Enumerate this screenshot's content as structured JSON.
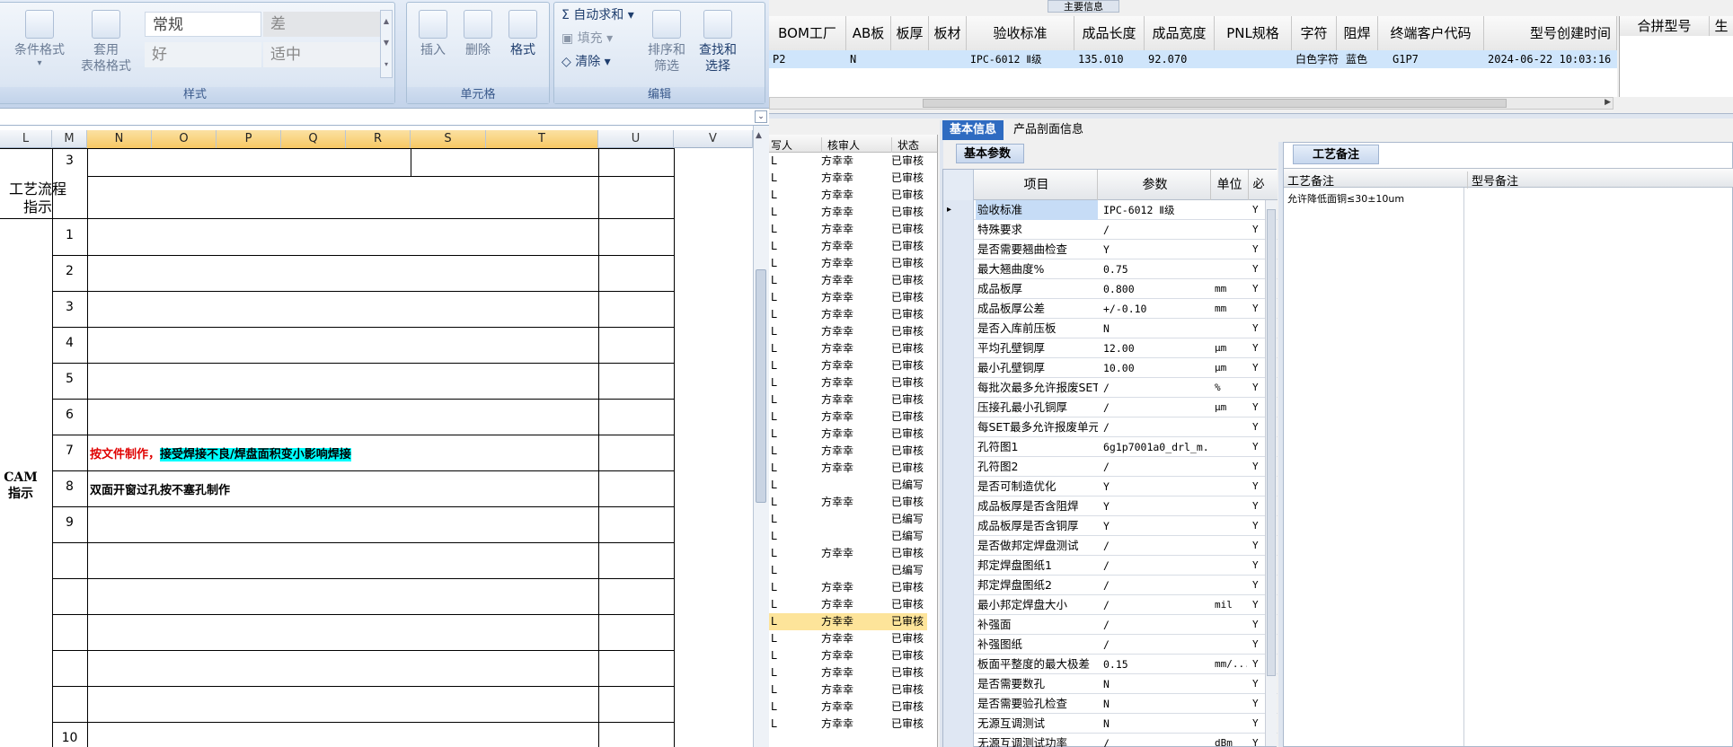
{
  "ribbon": {
    "cond_format": "条件格式",
    "table_format_1": "套用",
    "table_format_2": "表格格式",
    "style_normal": "常规",
    "style_bad": "差",
    "style_good": "好",
    "style_neutral": "适中",
    "styles_group": "样式",
    "insert": "插入",
    "delete": "删除",
    "format": "格式",
    "cells_group": "单元格",
    "autosum": "自动求和",
    "fill": "填充",
    "clear": "清除",
    "sort_1": "排序和",
    "sort_2": "筛选",
    "find_1": "查找和",
    "find_2": "选择",
    "edit_group": "编辑"
  },
  "sheet": {
    "columns": [
      "L",
      "M",
      "N",
      "O",
      "P",
      "Q",
      "R",
      "S",
      "T",
      "U",
      "V"
    ],
    "row_3": "3",
    "flow_label": "工艺流程\n指示",
    "cam_label": "CAM\n指示",
    "steps": [
      "1",
      "2",
      "3",
      "4",
      "5",
      "6",
      "7",
      "8",
      "9",
      "",
      "",
      "",
      "",
      "10"
    ],
    "step7_red": "按文件制作，",
    "step7_hl": "接受焊接不良/焊盘面积变小影响焊接",
    "step8": "双面开窗过孔按不塞孔制作"
  },
  "erp": {
    "main_title": "主要信息",
    "main_headers": [
      "BOM工厂",
      "AB板",
      "板厚",
      "板材",
      "验收标准",
      "成品长度",
      "成品宽度",
      "PNL规格",
      "字符",
      "阻焊",
      "终端客户代码",
      "型号创建时间"
    ],
    "main_row": [
      "P2",
      "N",
      "",
      "",
      "IPC-6012 Ⅱ级",
      "135.010",
      "92.070",
      "",
      "白色字符",
      "蓝色",
      "G1P7",
      "2024-06-22 10:03:16"
    ],
    "right_headers": [
      "合拼型号",
      "生"
    ],
    "list_headers": [
      "写人",
      "核审人",
      "状态"
    ],
    "list_rows": [
      [
        "L",
        "方幸幸",
        "已审核"
      ],
      [
        "L",
        "方幸幸",
        "已审核"
      ],
      [
        "L",
        "方幸幸",
        "已审核"
      ],
      [
        "L",
        "方幸幸",
        "已审核"
      ],
      [
        "L",
        "方幸幸",
        "已审核"
      ],
      [
        "L",
        "方幸幸",
        "已审核"
      ],
      [
        "L",
        "方幸幸",
        "已审核"
      ],
      [
        "L",
        "方幸幸",
        "已审核"
      ],
      [
        "L",
        "方幸幸",
        "已审核"
      ],
      [
        "L",
        "方幸幸",
        "已审核"
      ],
      [
        "L",
        "方幸幸",
        "已审核"
      ],
      [
        "L",
        "方幸幸",
        "已审核"
      ],
      [
        "L",
        "方幸幸",
        "已审核"
      ],
      [
        "L",
        "方幸幸",
        "已审核"
      ],
      [
        "L",
        "方幸幸",
        "已审核"
      ],
      [
        "L",
        "方幸幸",
        "已审核"
      ],
      [
        "L",
        "方幸幸",
        "已审核"
      ],
      [
        "L",
        "方幸幸",
        "已审核"
      ],
      [
        "L",
        "方幸幸",
        "已审核"
      ],
      [
        "L",
        "",
        "已编写"
      ],
      [
        "L",
        "方幸幸",
        "已审核"
      ],
      [
        "L",
        "",
        "已编写"
      ],
      [
        "L",
        "",
        "已编写"
      ],
      [
        "L",
        "方幸幸",
        "已审核"
      ],
      [
        "L",
        "",
        "已编写"
      ],
      [
        "L",
        "方幸幸",
        "已审核"
      ],
      [
        "L",
        "方幸幸",
        "已审核"
      ],
      [
        "L",
        "方幸幸",
        "已审核"
      ],
      [
        "L",
        "方幸幸",
        "已审核"
      ],
      [
        "L",
        "方幸幸",
        "已审核"
      ],
      [
        "L",
        "方幸幸",
        "已审核"
      ],
      [
        "L",
        "方幸幸",
        "已审核"
      ],
      [
        "L",
        "方幸幸",
        "已审核"
      ],
      [
        "L",
        "方幸幸",
        "已审核"
      ]
    ],
    "list_selected_index": 27,
    "tab_basic": "基本信息",
    "tab_profile": "产品剖面信息",
    "subtab_basic": "基本参数",
    "basic_headers": [
      "项目",
      "参数",
      "单位",
      "必"
    ],
    "basic_rows": [
      [
        "验收标准",
        "IPC-6012 Ⅱ级",
        "",
        "Y"
      ],
      [
        "特殊要求",
        "/",
        "",
        "Y"
      ],
      [
        "是否需要翘曲检查",
        "Y",
        "",
        "Y"
      ],
      [
        "最大翘曲度%",
        "0.75",
        "",
        "Y"
      ],
      [
        "成品板厚",
        "0.800",
        "mm",
        "Y"
      ],
      [
        "成品板厚公差",
        "+/-0.10",
        "mm",
        "Y"
      ],
      [
        "是否入库前压板",
        "N",
        "",
        "Y"
      ],
      [
        "平均孔壁铜厚",
        "12.00",
        "μm",
        "Y"
      ],
      [
        "最小孔壁铜厚",
        "10.00",
        "μm",
        "Y"
      ],
      [
        "每批次最多允许报废SET",
        "/",
        "%",
        "Y"
      ],
      [
        "压接孔最小孔铜厚",
        "/",
        "μm",
        "Y"
      ],
      [
        "每SET最多允许报废单元",
        "/",
        "",
        "Y"
      ],
      [
        "孔符图1",
        "6g1p7001a0_drl_m...",
        "",
        "Y"
      ],
      [
        "孔符图2",
        "/",
        "",
        "Y"
      ],
      [
        "是否可制造优化",
        "Y",
        "",
        "Y"
      ],
      [
        "成品板厚是否含阻焊",
        "Y",
        "",
        "Y"
      ],
      [
        "成品板厚是否含铜厚",
        "Y",
        "",
        "Y"
      ],
      [
        "是否做邦定焊盘测试",
        "/",
        "",
        "Y"
      ],
      [
        "邦定焊盘图纸1",
        "/",
        "",
        "Y"
      ],
      [
        "邦定焊盘图纸2",
        "/",
        "",
        "Y"
      ],
      [
        "最小邦定焊盘大小",
        "/",
        "mil",
        "Y"
      ],
      [
        "补强面",
        "/",
        "",
        "Y"
      ],
      [
        "补强图纸",
        "/",
        "",
        "Y"
      ],
      [
        "板面平整度的最大极差",
        "0.15",
        "mm/...",
        "Y"
      ],
      [
        "是否需要数孔",
        "N",
        "",
        "Y"
      ],
      [
        "是否需要验孔检查",
        "N",
        "",
        "Y"
      ],
      [
        "无源互调测试",
        "N",
        "",
        "Y"
      ],
      [
        "无源互调测试功率",
        "/",
        "dBm",
        "Y"
      ]
    ],
    "craft_tab": "工艺备注",
    "craft_header": "工艺备注",
    "model_header": "型号备注",
    "craft_text": "允许降低面铜≤30±10um"
  }
}
